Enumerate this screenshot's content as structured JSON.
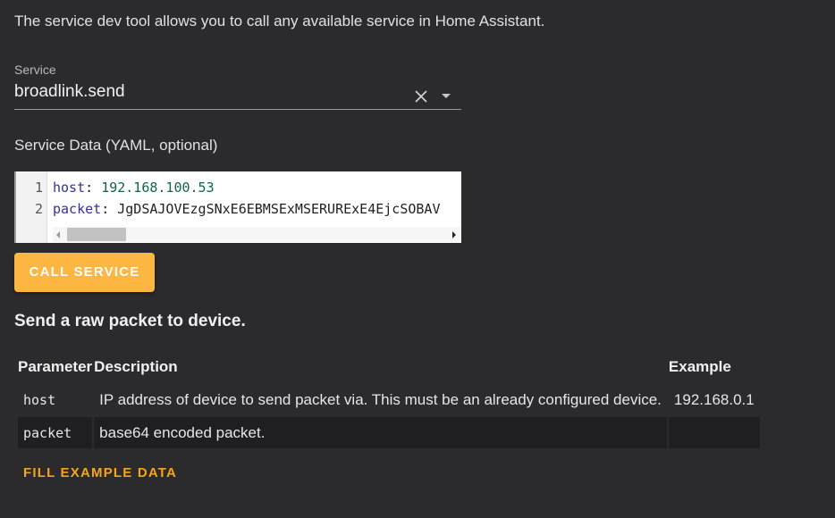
{
  "intro_text": "The service dev tool allows you to call any available service in Home Assistant.",
  "service": {
    "label": "Service",
    "value": "broadlink.send"
  },
  "yaml": {
    "label": "Service Data (YAML, optional)",
    "lines": [
      {
        "num": "1",
        "key": "host",
        "sep": ": ",
        "value": "192.168.100.53"
      },
      {
        "num": "2",
        "key": "packet",
        "sep": ": ",
        "value": "JgDSAJOVEzgSNxE6EBMSExMSERURExE4EjcSOBAV"
      }
    ]
  },
  "call_button": "CALL SERVICE",
  "description_title": "Send a raw packet to device.",
  "table": {
    "headers": [
      "Parameter",
      "Description",
      "Example"
    ],
    "rows": [
      {
        "parameter": "host",
        "description": "IP address of device to send packet via. This must be an already configured device.",
        "example": "192.168.0.1"
      },
      {
        "parameter": "packet",
        "description": "base64 encoded packet.",
        "example": ""
      }
    ]
  },
  "fill_button": "FILL EXAMPLE DATA",
  "colors": {
    "background": "#2b2b2d",
    "accent": "#fdb641",
    "link": "#f4a51c"
  }
}
